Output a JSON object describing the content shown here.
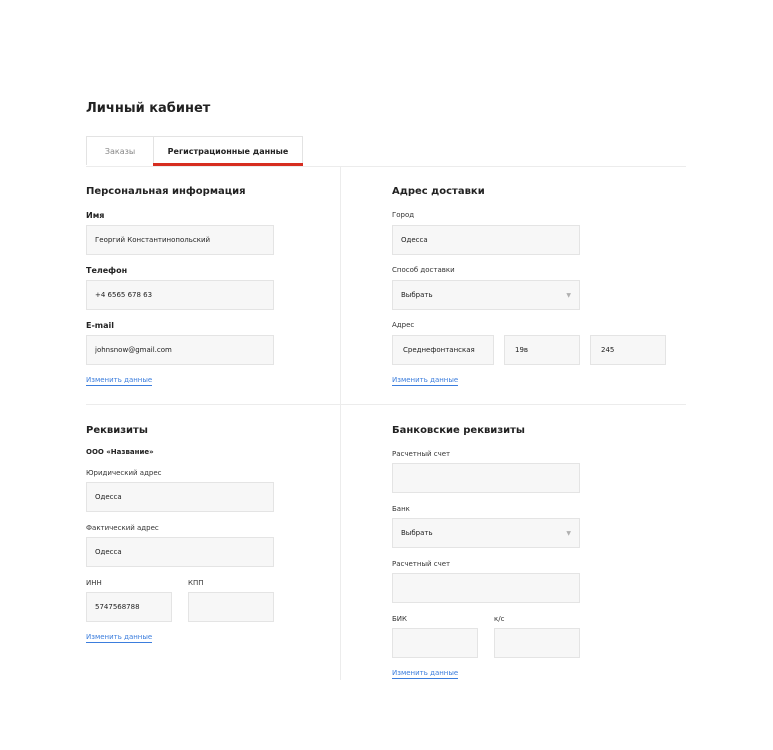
{
  "page_title": "Личный кабинет",
  "tabs": {
    "orders": "Заказы",
    "registration": "Регистрационные данные",
    "active_color": "#d62d20"
  },
  "personal": {
    "title": "Персональная информация",
    "name_label": "Имя",
    "name_value": "Георгий Константинопольский",
    "phone_label": "Телефон",
    "phone_value": "+4 6565 678 63",
    "email_label": "E-mail",
    "email_value": "johnsnow@gmail.com",
    "edit_link": "Изменить данные"
  },
  "delivery": {
    "title": "Адрес доставки",
    "city_label": "Город",
    "city_value": "Одесса",
    "method_label": "Способ доставки",
    "method_value": "Выбрать",
    "address_label": "Адрес",
    "street_value": "Среднефонтанская",
    "house_value": "19в",
    "apartment_value": "245",
    "edit_link": "Изменить данные"
  },
  "requisites": {
    "title": "Реквизиты",
    "company_name": "ООО «Название»",
    "legal_address_label": "Юридический адрес",
    "legal_address_value": "Одесса",
    "actual_address_label": "Фактический адрес",
    "actual_address_value": "Одесса",
    "inn_label": "ИНН",
    "inn_value": "5747568788",
    "kpp_label": "КПП",
    "kpp_value": "",
    "edit_link": "Изменить данные"
  },
  "bank": {
    "title": "Банковские реквизиты",
    "account_label": "Расчетный счет",
    "account_value": "",
    "bank_label": "Банк",
    "bank_value": "Выбрать",
    "account2_label": "Расчетный счет",
    "account2_value": "",
    "bik_label": "БИК",
    "bik_value": "",
    "ks_label": "к/с",
    "ks_value": "",
    "edit_link": "Изменить данные"
  },
  "icons": {
    "select_chevron": "chevron-down-icon"
  },
  "link_color": "#3b7ddd"
}
